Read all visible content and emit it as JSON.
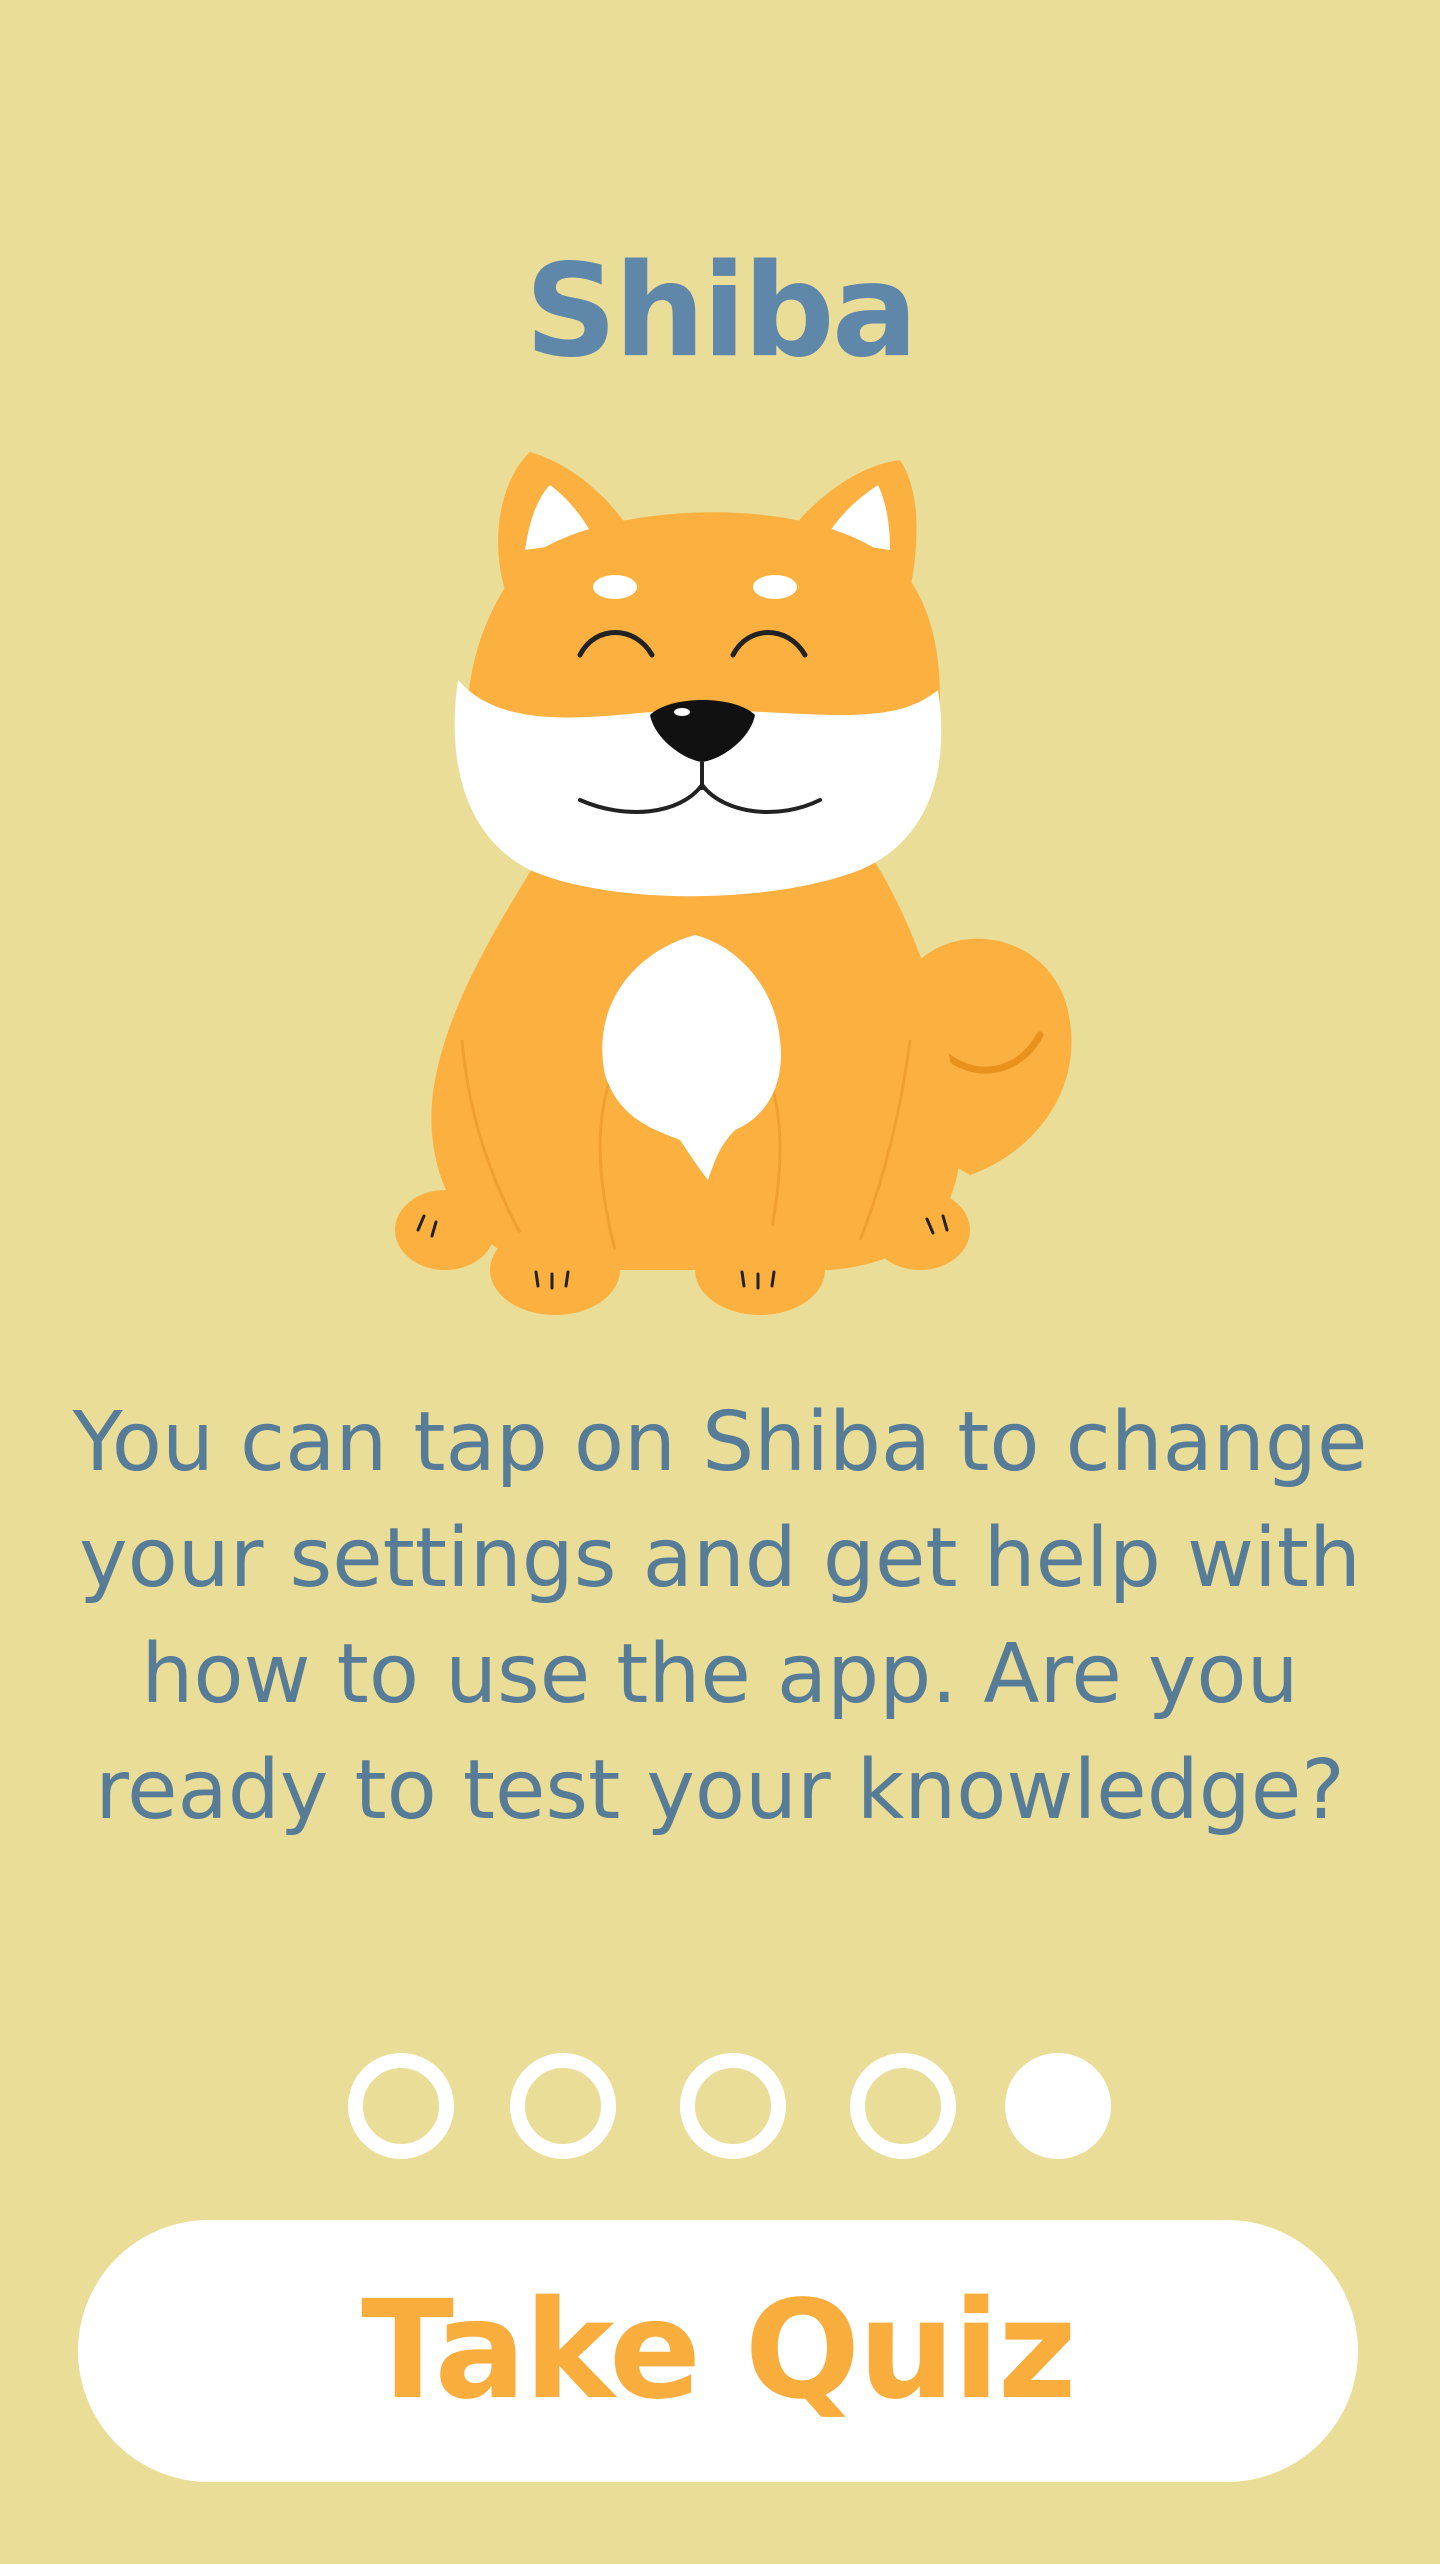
{
  "header": {
    "title": "Shiba"
  },
  "mascot": {
    "name": "shiba-dog-illustration"
  },
  "onboarding": {
    "message": "You can tap on Shiba to change your settings and get help with how to use the app. Are you ready to test your knowledge?",
    "page_total": 5,
    "page_current": 5
  },
  "actions": {
    "take_quiz_label": "Take Quiz"
  },
  "colors": {
    "background": "#e9dd98",
    "title": "#5f87aa",
    "body_text": "#567c97",
    "accent": "#f9ad3d",
    "dog_orange": "#fbb040",
    "white": "#ffffff"
  }
}
